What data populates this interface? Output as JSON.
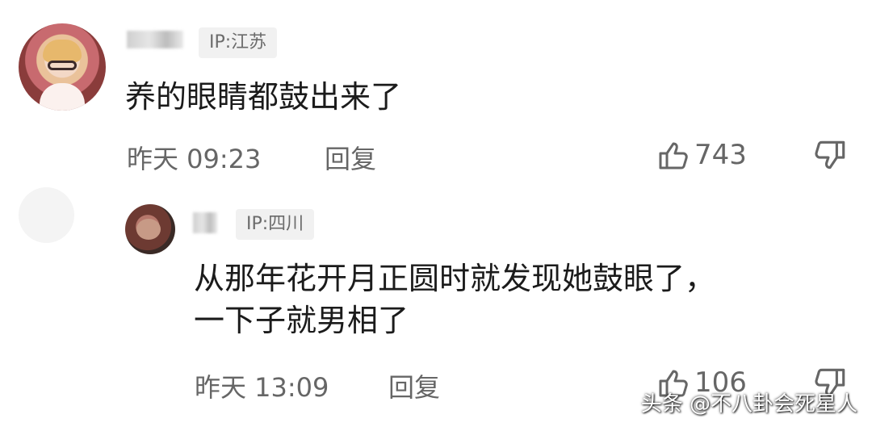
{
  "main_comment": {
    "ip_label": "IP:江苏",
    "text": "养的眼睛都鼓出来了",
    "time": "昨天 09:23",
    "reply_label": "回复",
    "like_count": "743",
    "like_icon": "thumbs-up-icon",
    "dislike_icon": "thumbs-down-icon"
  },
  "reply_comment": {
    "ip_label": "IP:四川",
    "text_line1": "从那年花开月正圆时就发现她鼓眼了，",
    "text_line2": "一下子就男相了",
    "time": "昨天 13:09",
    "reply_label": "回复",
    "like_count": "106",
    "like_icon": "thumbs-up-icon",
    "dislike_icon": "thumbs-down-icon"
  },
  "watermark": "头条 @不八卦会死星人"
}
